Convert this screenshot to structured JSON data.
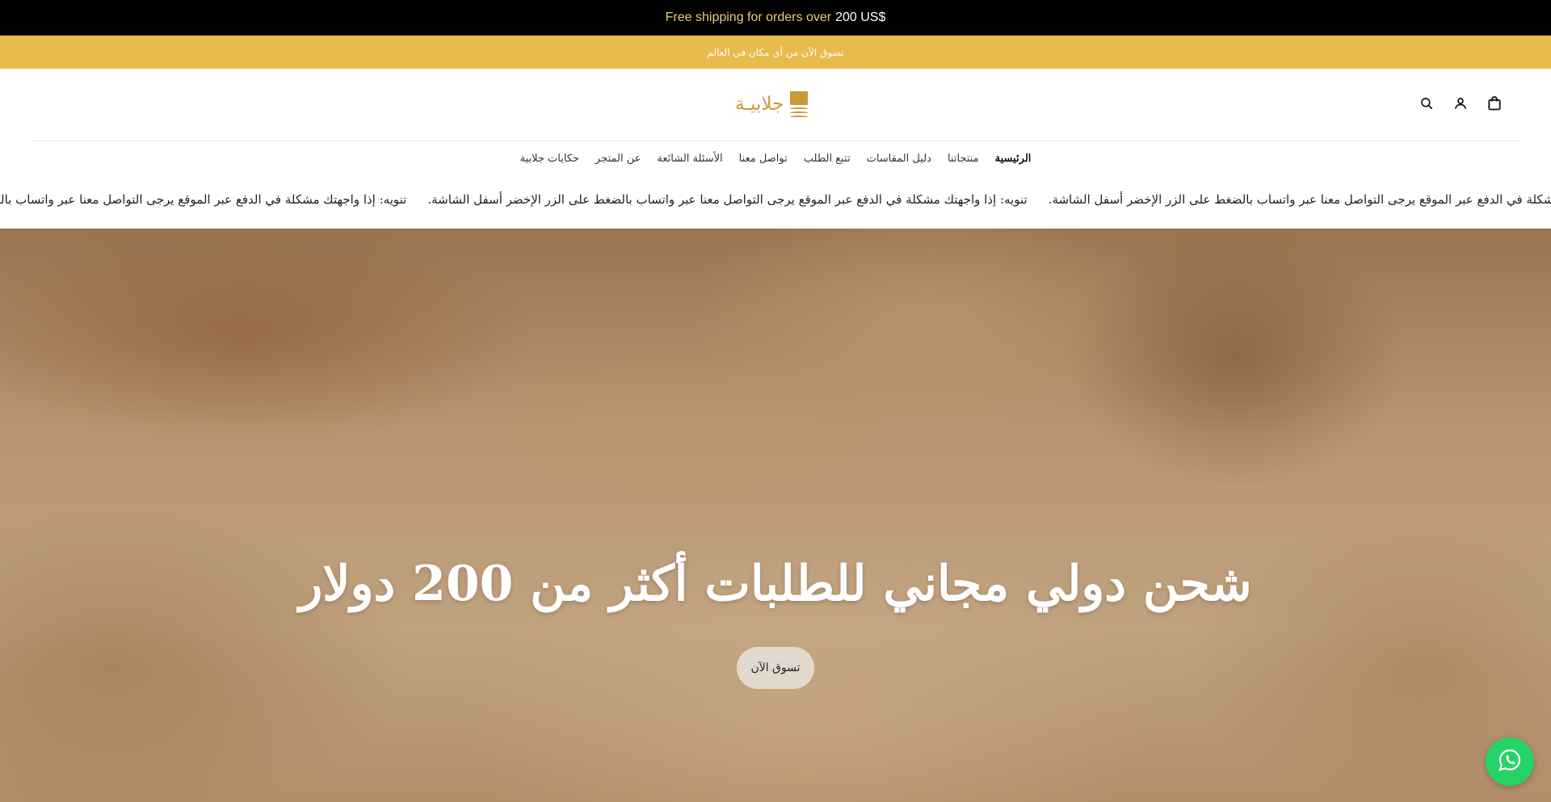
{
  "topbar": {
    "text": "Free shipping for orders over",
    "amount": "200 US$"
  },
  "announcement": {
    "text": "تسوق الآن من أي مكان في العالم"
  },
  "logo": {
    "text": "جلابيـة",
    "color": "#c99a3a"
  },
  "header_icons": [
    "search-icon",
    "account-icon",
    "cart-icon"
  ],
  "nav": {
    "items": [
      {
        "label": "الرئيسية",
        "active": true
      },
      {
        "label": "منتجاتنا"
      },
      {
        "label": "دليل المقاسات"
      },
      {
        "label": "تتبع الطلب"
      },
      {
        "label": "تواصل معنا"
      },
      {
        "label": "الأسئلة الشائعة"
      },
      {
        "label": "عن المتجر"
      },
      {
        "label": "حكايات جلابية"
      }
    ]
  },
  "marquee": {
    "message": "تنويه: إذا واجهتك مشكلة في الدفع عبر الموقع يرجى التواصل معنا عبر واتساب بالضغط على الزر الإخضر أسفل الشاشة."
  },
  "hero": {
    "title": "شحن دولي مجاني للطلبات أكثر من 200 دولار",
    "button_label": "تسوق الآن"
  },
  "colors": {
    "announcement_bg": "#e8bb4d",
    "topbar_text": "#f0c97a",
    "whatsapp": "#25d366"
  }
}
